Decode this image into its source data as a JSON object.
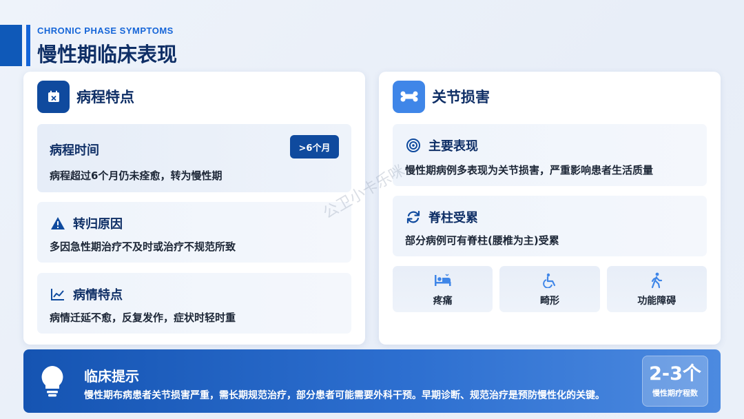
{
  "header": {
    "subtitle": "CHRONIC PHASE SYMPTOMS",
    "title": "慢性期临床表现"
  },
  "left_card": {
    "title": "病程特点",
    "icon": "calendar-icon",
    "sections": [
      {
        "title": "病程时间",
        "badge": ">6个月",
        "body": "病程超过6个月仍未痊愈，转为慢性期"
      },
      {
        "title": "转归原因",
        "icon": "warning-icon",
        "body": "多因急性期治疗不及时或治疗不规范所致"
      },
      {
        "title": "病情特点",
        "icon": "chart-line-icon",
        "body": "病情迁延不愈，反复发作，症状时轻时重"
      }
    ]
  },
  "right_card": {
    "title": "关节损害",
    "icon": "bone-icon",
    "sections": [
      {
        "title": "主要表现",
        "icon": "target-icon",
        "body": "慢性期病例多表现为关节损害，严重影响患者生活质量"
      },
      {
        "title": "脊柱受累",
        "icon": "sync-icon",
        "body": "部分病例可有脊柱(腰椎为主)受累"
      }
    ],
    "tiles": [
      {
        "label": "疼痛",
        "icon": "bed-icon"
      },
      {
        "label": "畸形",
        "icon": "wheelchair-icon"
      },
      {
        "label": "功能障碍",
        "icon": "walking-icon"
      }
    ]
  },
  "banner": {
    "title": "临床提示",
    "icon": "lightbulb-icon",
    "text": "慢性期布病患者关节损害严重，需长期规范治疗，部分患者可能需要外科干预。早期诊断、规范治疗是预防慢性化的关键。",
    "stat_value": "2-3个",
    "stat_label": "慢性期疗程数"
  },
  "watermark": "公卫小卡乐咪",
  "colors": {
    "primary": "#0f4a9e",
    "accent": "#1565d8",
    "light_accent": "#3f86e8",
    "title": "#0f2f66"
  }
}
